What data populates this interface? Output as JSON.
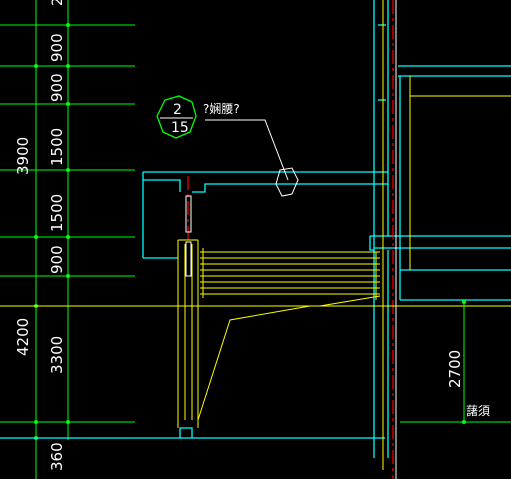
{
  "drawing": {
    "detail_marker": {
      "number": "2",
      "sheet": "15",
      "note": "?娴腰?"
    },
    "dimensions_outer": {
      "total_upper": "3900",
      "total_lower": "4200",
      "bottom": "360"
    },
    "dimensions_inner": {
      "d1": "900",
      "d2": "900",
      "d3": "1500",
      "d4": "1500",
      "d5": "900",
      "d6": "3300"
    },
    "right_dimension": "2700",
    "floor_label": "藷須",
    "colors": {
      "background": "#000000",
      "dimension_line": "#00ff00",
      "wall": "#00ffff",
      "yellow": "#ffff00",
      "red": "#ff0000",
      "marker_green": "#00ff00",
      "white": "#ffffff"
    }
  }
}
